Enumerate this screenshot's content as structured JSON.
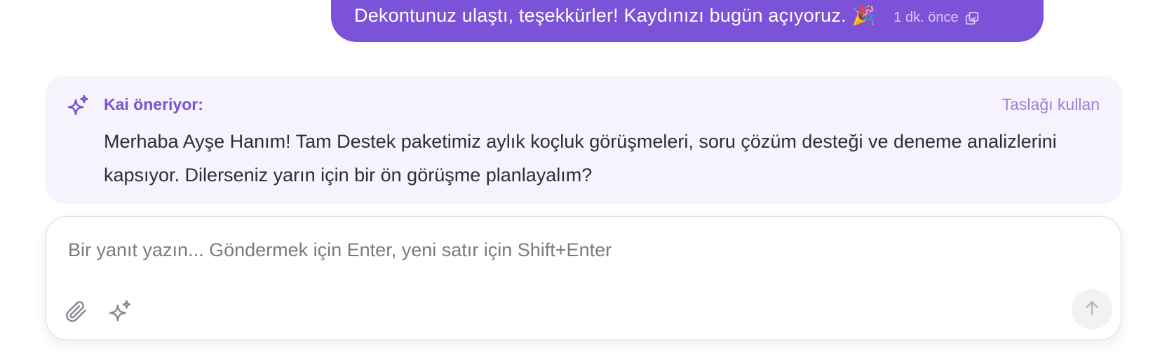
{
  "outgoing_message": {
    "text": "Dekontunuz ulaştı, teşekkürler! Kaydınızı bugün açıyoruz. 🎉",
    "timestamp": "1 dk. önce",
    "status_icon": "copy-icon"
  },
  "suggestion": {
    "icon": "sparkles-icon",
    "title": "Kai öneriyor:",
    "action_label": "Taslağı kullan",
    "body": "Merhaba Ayşe Hanım! Tam Destek paketimiz aylık koçluk görüşmeleri, soru çözüm desteği ve deneme analizlerini kapsıyor. Dilerseniz yarın için bir ön görüşme planlayalım?"
  },
  "composer": {
    "placeholder": "Bir yanıt yazın... Göndermek için Enter, yeni satır için Shift+Enter",
    "value": "",
    "attach_icon": "paperclip-icon",
    "ai_icon": "sparkles-icon",
    "send_icon": "arrow-up-icon"
  },
  "colors": {
    "accent": "#7c52d9",
    "suggestion_bg": "#f6f3fd",
    "suggestion_title": "#7a52cc"
  }
}
